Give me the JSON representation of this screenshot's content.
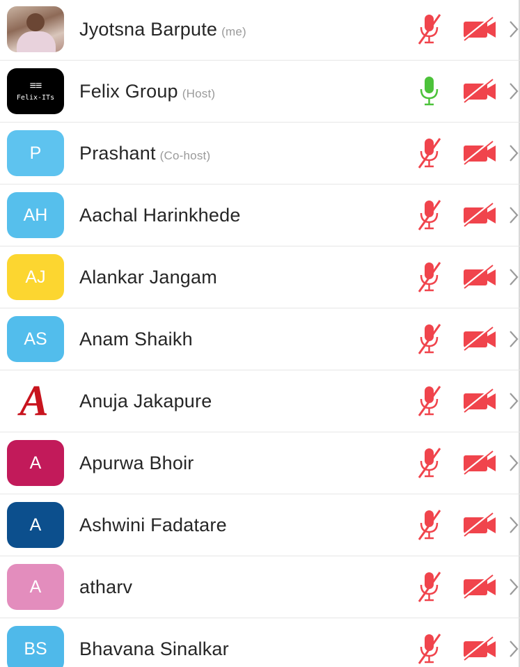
{
  "participants": [
    {
      "name": "Jyotsna Barpute",
      "tag": "(me)",
      "avatar": {
        "type": "photo",
        "initials": "",
        "color": ""
      },
      "mic": "muted",
      "video": "off"
    },
    {
      "name": "Felix Group",
      "tag": "(Host)",
      "avatar": {
        "type": "logo",
        "initials": "",
        "logo_text": "Felix-ITs",
        "color": "#000000"
      },
      "mic": "on",
      "video": "off"
    },
    {
      "name": "Prashant",
      "tag": "(Co-host)",
      "avatar": {
        "type": "initials",
        "initials": "P",
        "color": "#5ec3ef"
      },
      "mic": "muted",
      "video": "off"
    },
    {
      "name": "Aachal Harinkhede",
      "tag": "",
      "avatar": {
        "type": "initials",
        "initials": "AH",
        "color": "#56bfec"
      },
      "mic": "muted",
      "video": "off"
    },
    {
      "name": "Alankar Jangam",
      "tag": "",
      "avatar": {
        "type": "initials",
        "initials": "AJ",
        "color": "#fcd630"
      },
      "mic": "muted",
      "video": "off"
    },
    {
      "name": "Anam Shaikh",
      "tag": "",
      "avatar": {
        "type": "initials",
        "initials": "AS",
        "color": "#52bdec"
      },
      "mic": "muted",
      "video": "off"
    },
    {
      "name": "Anuja Jakapure",
      "tag": "",
      "avatar": {
        "type": "script",
        "initials": "A",
        "color": "#c8141e"
      },
      "mic": "muted",
      "video": "off"
    },
    {
      "name": "Apurwa Bhoir",
      "tag": "",
      "avatar": {
        "type": "initials",
        "initials": "A",
        "color": "#c21a5a"
      },
      "mic": "muted",
      "video": "off"
    },
    {
      "name": "Ashwini Fadatare",
      "tag": "",
      "avatar": {
        "type": "initials",
        "initials": "A",
        "color": "#0c4f8d"
      },
      "mic": "muted",
      "video": "off"
    },
    {
      "name": "atharv",
      "tag": "",
      "avatar": {
        "type": "initials",
        "initials": "A",
        "color": "#e38dbd"
      },
      "mic": "muted",
      "video": "off"
    },
    {
      "name": "Bhavana Sinalkar",
      "tag": "",
      "avatar": {
        "type": "initials",
        "initials": "BS",
        "color": "#4fb9ea"
      },
      "mic": "muted",
      "video": "off"
    }
  ],
  "colors": {
    "muted_red": "#f0444c",
    "mic_on_green": "#4cc23a",
    "chevron": "#9a9a9a"
  },
  "icons": {
    "mic_muted": "mic-muted-icon",
    "mic_on": "mic-icon",
    "video_off": "video-off-icon",
    "chevron": "chevron-right-icon"
  }
}
